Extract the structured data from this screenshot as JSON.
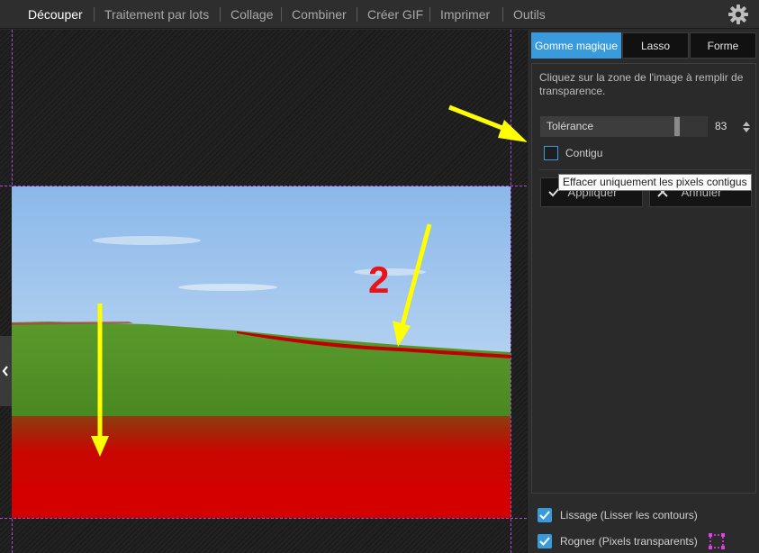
{
  "menu": {
    "items": [
      {
        "label": "Découper",
        "active": true
      },
      {
        "label": "Traitement par lots",
        "active": false
      },
      {
        "label": "Collage",
        "active": false
      },
      {
        "label": "Combiner",
        "active": false
      },
      {
        "label": "Créer GIF",
        "active": false
      },
      {
        "label": "Imprimer",
        "active": false
      },
      {
        "label": "Outils",
        "active": false
      }
    ],
    "settings_icon": "gear-icon"
  },
  "panel": {
    "tabs": [
      {
        "label": "Gomme magique",
        "active": true
      },
      {
        "label": "Lasso",
        "active": false
      },
      {
        "label": "Forme",
        "active": false
      }
    ],
    "description": "Cliquez sur la zone de l'image à remplir de transparence.",
    "tolerance": {
      "label": "Tolérance",
      "value": "83",
      "fraction": 0.83
    },
    "contiguous": {
      "label": "Contigu",
      "checked": false
    },
    "tooltip": "Effacer uniquement les pixels contigus",
    "apply_label": "Appliquer",
    "cancel_label": "Annuler",
    "options": [
      {
        "label": "Lissage (Lisser les contours)",
        "checked": true
      },
      {
        "label": "Rogner (Pixels transparents)",
        "checked": true
      }
    ]
  },
  "annotation": {
    "number": "2",
    "number_color": "#e8141c",
    "arrow_color": "#ffff00"
  },
  "colors": {
    "accent": "#3a9bdc",
    "guide": "#b04ad8",
    "selection": "#d40000"
  }
}
